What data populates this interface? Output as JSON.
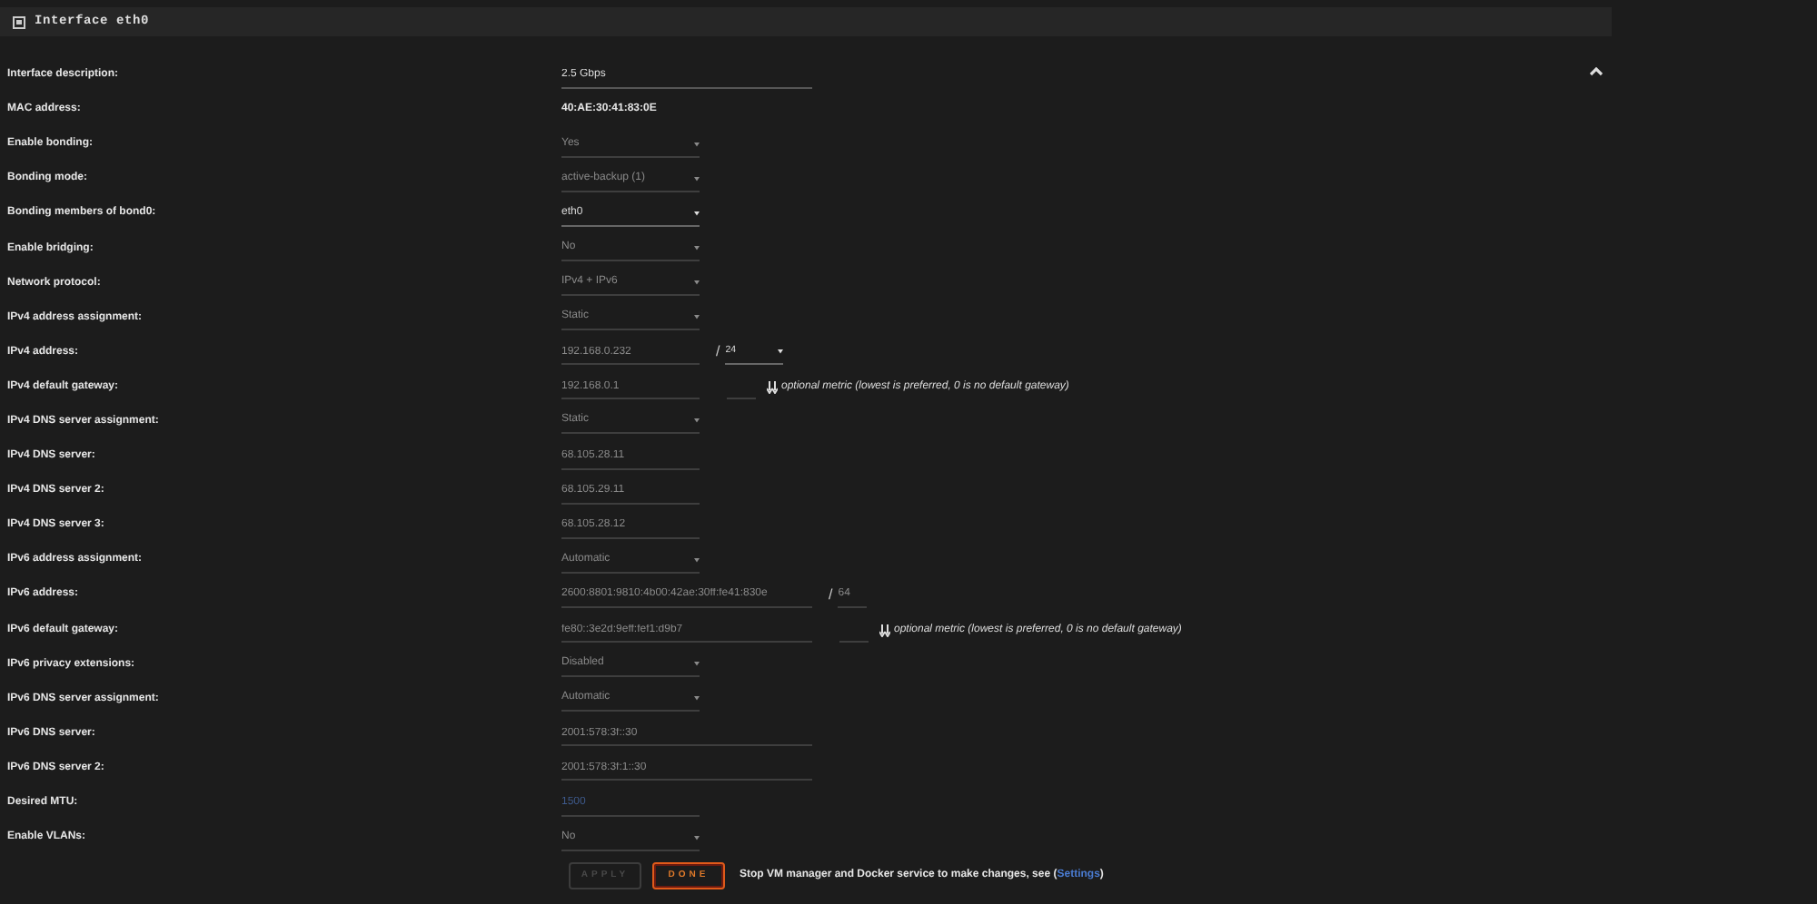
{
  "panel": {
    "title": "Interface eth0",
    "collapsed": false
  },
  "rows": [
    {
      "label": "Interface description:",
      "kind": "text_long",
      "value": "2.5 Gbps",
      "disabled": false
    },
    {
      "label": "MAC address:",
      "kind": "static",
      "value": "40:AE:30:41:83:0E"
    },
    {
      "label": "Enable bonding:",
      "kind": "select",
      "value": "Yes",
      "disabled": true
    },
    {
      "label": "Bonding mode:",
      "kind": "select",
      "value": "active-backup (1)",
      "disabled": true
    },
    {
      "label": "Bonding members of bond0:",
      "kind": "select",
      "value": "eth0",
      "disabled": false
    },
    {
      "label": "Enable bridging:",
      "kind": "select",
      "value": "No",
      "disabled": true
    },
    {
      "label": "Network protocol:",
      "kind": "select",
      "value": "IPv4 + IPv6",
      "disabled": true
    },
    {
      "label": "IPv4 address assignment:",
      "kind": "select",
      "value": "Static",
      "disabled": true
    },
    {
      "label": "IPv4 address:",
      "kind": "text",
      "value": "192.168.0.232",
      "disabled": true,
      "prefix": {
        "separator": "/",
        "kind": "select",
        "value": "24"
      }
    },
    {
      "label": "IPv4 default gateway:",
      "kind": "text",
      "value": "192.168.0.1",
      "disabled": true,
      "metric": {
        "note": "optional metric (lowest is preferred, 0 is no default gateway)"
      }
    },
    {
      "label": "IPv4 DNS server assignment:",
      "kind": "select",
      "value": "Static",
      "disabled": true
    },
    {
      "label": "IPv4 DNS server:",
      "kind": "text",
      "value": "68.105.28.11",
      "disabled": true
    },
    {
      "label": "IPv4 DNS server 2:",
      "kind": "text",
      "value": "68.105.29.11",
      "disabled": true
    },
    {
      "label": "IPv4 DNS server 3:",
      "kind": "text",
      "value": "68.105.28.12",
      "disabled": true
    },
    {
      "label": "IPv6 address assignment:",
      "kind": "select",
      "value": "Automatic",
      "disabled": true
    },
    {
      "label": "IPv6 address:",
      "kind": "text_long",
      "value": "2600:8801:9810:4b00:42ae:30ff:fe41:830e",
      "disabled": true,
      "prefix": {
        "separator": "/",
        "kind": "text",
        "value": "64"
      }
    },
    {
      "label": "IPv6 default gateway:",
      "kind": "text_long",
      "value": "fe80::3e2d:9eff:fef1:d9b7",
      "disabled": true,
      "metric": {
        "note": "optional metric (lowest is preferred, 0 is no default gateway)"
      }
    },
    {
      "label": "IPv6 privacy extensions:",
      "kind": "select",
      "value": "Disabled",
      "disabled": true
    },
    {
      "label": "IPv6 DNS server assignment:",
      "kind": "select",
      "value": "Automatic",
      "disabled": true
    },
    {
      "label": "IPv6 DNS server:",
      "kind": "text_long",
      "value": "2001:578:3f::30",
      "disabled": true
    },
    {
      "label": "IPv6 DNS server 2:",
      "kind": "text_long",
      "value": "2001:578:3f:1::30",
      "disabled": true
    },
    {
      "label": "Desired MTU:",
      "kind": "text",
      "placeholder": "1500",
      "disabled": true
    },
    {
      "label": "Enable VLANs:",
      "kind": "select",
      "value": "No",
      "disabled": true
    }
  ],
  "buttons": [
    {
      "label": "APPLY",
      "kind": "apply",
      "disabled": true
    },
    {
      "label": "DONE",
      "kind": "done",
      "disabled": false
    }
  ],
  "notice": {
    "text": "Stop VM manager and Docker service to make changes, see (",
    "link": "Settings",
    "tail": ")"
  }
}
